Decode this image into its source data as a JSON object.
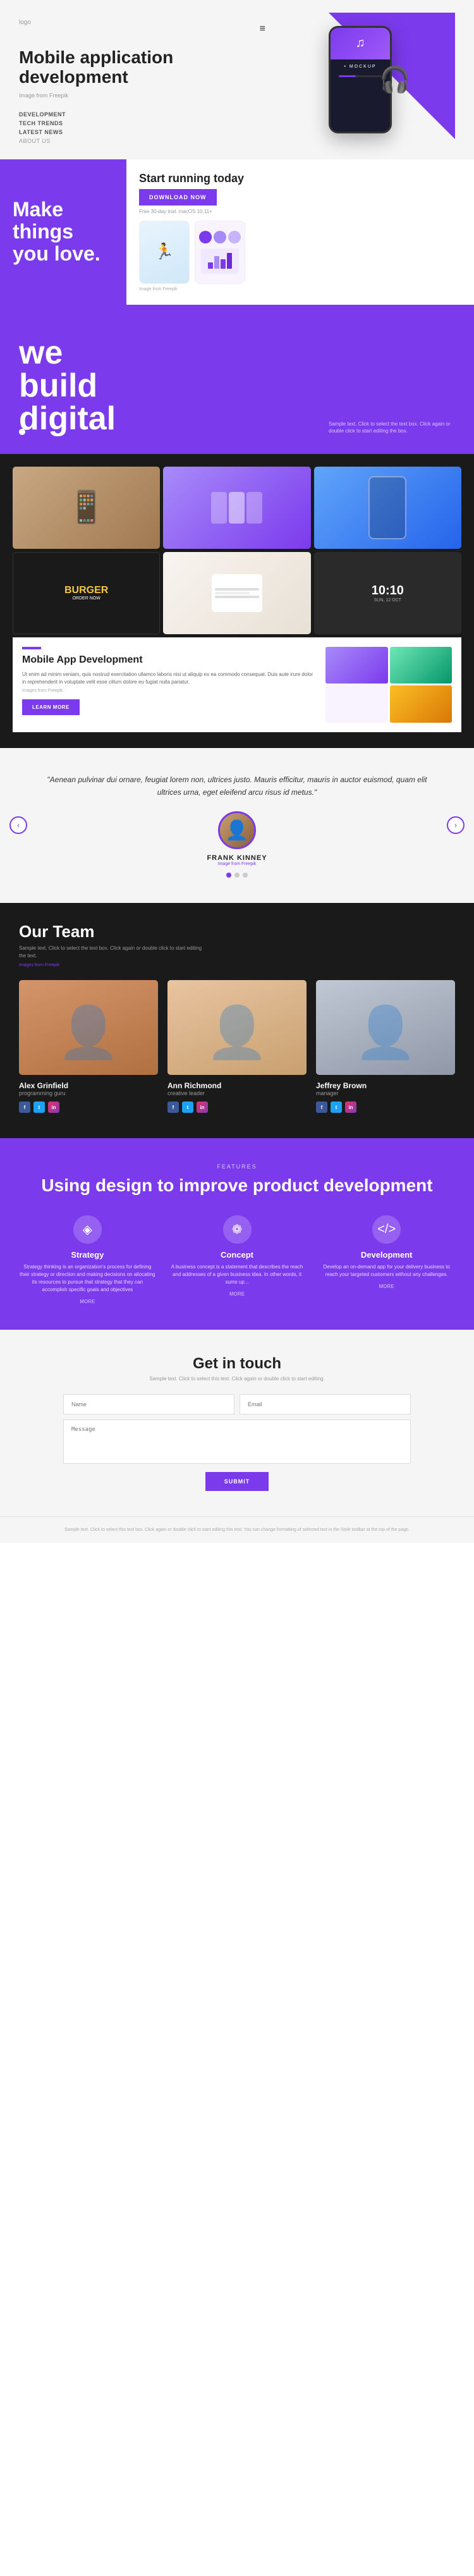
{
  "header": {
    "logo": "logo",
    "menu_icon": "≡"
  },
  "hero": {
    "title": "Mobile application development",
    "image_label": "Image from Freepik",
    "nav": [
      "DEVELOPMENT",
      "TECH TRENDS",
      "LATEST NEWS",
      "ABOUT US"
    ],
    "mockup_label": "• MOCKUP"
  },
  "make": {
    "title": "Make things you love.",
    "running_title": "Start running today",
    "download_label": "DOWNLOAD NOW",
    "trial_text": "Free 30-day trial. macOS 10.11+",
    "image_label": "Image from Freepik"
  },
  "build": {
    "title_line1": "we",
    "title_line2": "build",
    "title_line3": "digital",
    "sample_text": "Sample text. Click to select the text box. Click again or double click to start editing the box."
  },
  "mobile_app_card": {
    "title": "Mobile App Development",
    "description": "Ut enim ad minim veniam, quis nostrud exercitation ullamco laboris nisi ut aliquip ex ea commodo consequat. Duis aute irure dolor in reprehenderit in voluptate velit esse cillum dolore eu fugiat nulla pariatur.",
    "image_label": "Images from Freepik",
    "learn_more": "LEARN MORE"
  },
  "testimonial": {
    "quote": "\"Aenean pulvinar dui ornare, feugiat lorem non, ultrices justo. Mauris efficitur, mauris in auctor euismod, quam elit ultrices urna, eget eleifend arcu risus id metus.\"",
    "name": "FRANK KINNEY",
    "image_label": "Image from Freepik"
  },
  "team": {
    "title": "Our Team",
    "subtitle": "Sample text. Click to select the text box. Click again or double click to start editing the text.",
    "credit": "Images from Freepik",
    "members": [
      {
        "name": "Alex Grinfield",
        "role": "programming guru"
      },
      {
        "name": "Ann Richmond",
        "role": "creative leader"
      },
      {
        "name": "Jeffrey Brown",
        "role": "manager"
      }
    ]
  },
  "features": {
    "label": "FEATURES",
    "title": "Using design to improve product development",
    "items": [
      {
        "name": "Strategy",
        "icon": "◈",
        "description": "Strategy thinking is an organization's process for defining their strategy or direction and making decisions on allocating its resources to pursue that strategy that they can accomplish specific goals and objectives",
        "more": "MORE"
      },
      {
        "name": "Concept",
        "icon": "❁",
        "description": "A business concept is a statement that describes the reach and addresses of a given business idea. In other words, it sums up...",
        "more": "MORE"
      },
      {
        "name": "Development",
        "icon": "</>",
        "description": "Develop an on-demand app for your delivery business to reach your targeted customers without any challenges.",
        "more": "MORE"
      }
    ]
  },
  "contact": {
    "title": "Get in touch",
    "subtitle": "Sample text. Click to select this text. Click again or double click to start editing.",
    "name_placeholder": "Name",
    "email_placeholder": "Email",
    "message_placeholder": "Message",
    "submit_label": "SUBMIT"
  },
  "footer": {
    "text": "Sample text. Click to select this text box. Click again or double click to start editing this text. You can change formatting of selected text in the Style toolbar at the top of the page."
  }
}
